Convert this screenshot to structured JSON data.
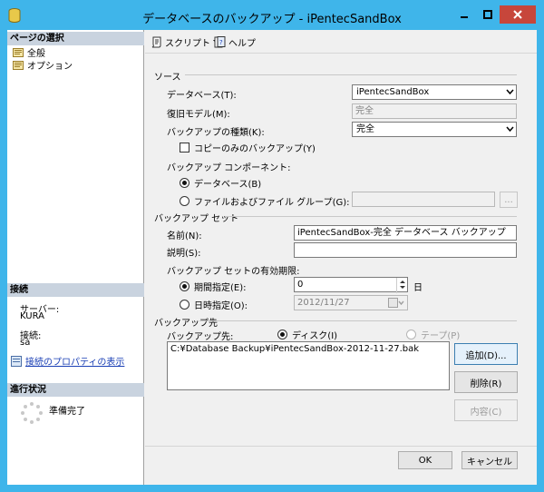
{
  "window": {
    "title": "データベースのバックアップ - iPentecSandBox"
  },
  "left": {
    "pages_header": "ページの選択",
    "pages": [
      {
        "label": "全般",
        "icon": "page-icon"
      },
      {
        "label": "オプション",
        "icon": "page-icon"
      }
    ],
    "connection_header": "接続",
    "server_label": "サーバー:",
    "server_value": "KURA",
    "connection_label": "接続:",
    "connection_value": "sa",
    "connection_props_link": "接続のプロパティの表示",
    "progress_header": "進行状況",
    "progress_status": "準備完了"
  },
  "toolbar": {
    "script_label": "スクリプト",
    "help_label": "ヘルプ"
  },
  "source": {
    "section_label": "ソース",
    "database_label": "データベース(T):",
    "database_value": "iPentecSandBox",
    "recovery_label": "復旧モデル(M):",
    "recovery_value": "完全",
    "backup_type_label": "バックアップの種類(K):",
    "backup_type_value": "完全",
    "copy_only_label": "コピーのみのバックアップ(Y)",
    "component_label": "バックアップ コンポーネント:",
    "component_database_label": "データベース(B)",
    "component_files_label": "ファイルおよびファイル グループ(G):",
    "browse_label": "..."
  },
  "backup_set": {
    "section_label": "バックアップ セット",
    "name_label": "名前(N):",
    "name_value": "iPentecSandBox-完全 データベース バックアップ",
    "description_label": "説明(S):",
    "description_value": "",
    "expiry_label": "バックアップ セットの有効期限:",
    "after_label": "期間指定(E):",
    "after_value": "0",
    "after_unit": "日",
    "on_label": "日時指定(O):",
    "on_value": "2012/11/27"
  },
  "destination": {
    "section_label": "バックアップ先",
    "backup_to_label": "バックアップ先:",
    "disk_label": "ディスク(I)",
    "tape_label": "テープ(P)",
    "paths": [
      "C:¥Database Backup¥iPentecSandBox-2012-11-27.bak"
    ],
    "add_label": "追加(D)...",
    "remove_label": "削除(R)",
    "contents_label": "内容(C)"
  },
  "footer": {
    "ok_label": "OK",
    "cancel_label": "キャンセル"
  }
}
